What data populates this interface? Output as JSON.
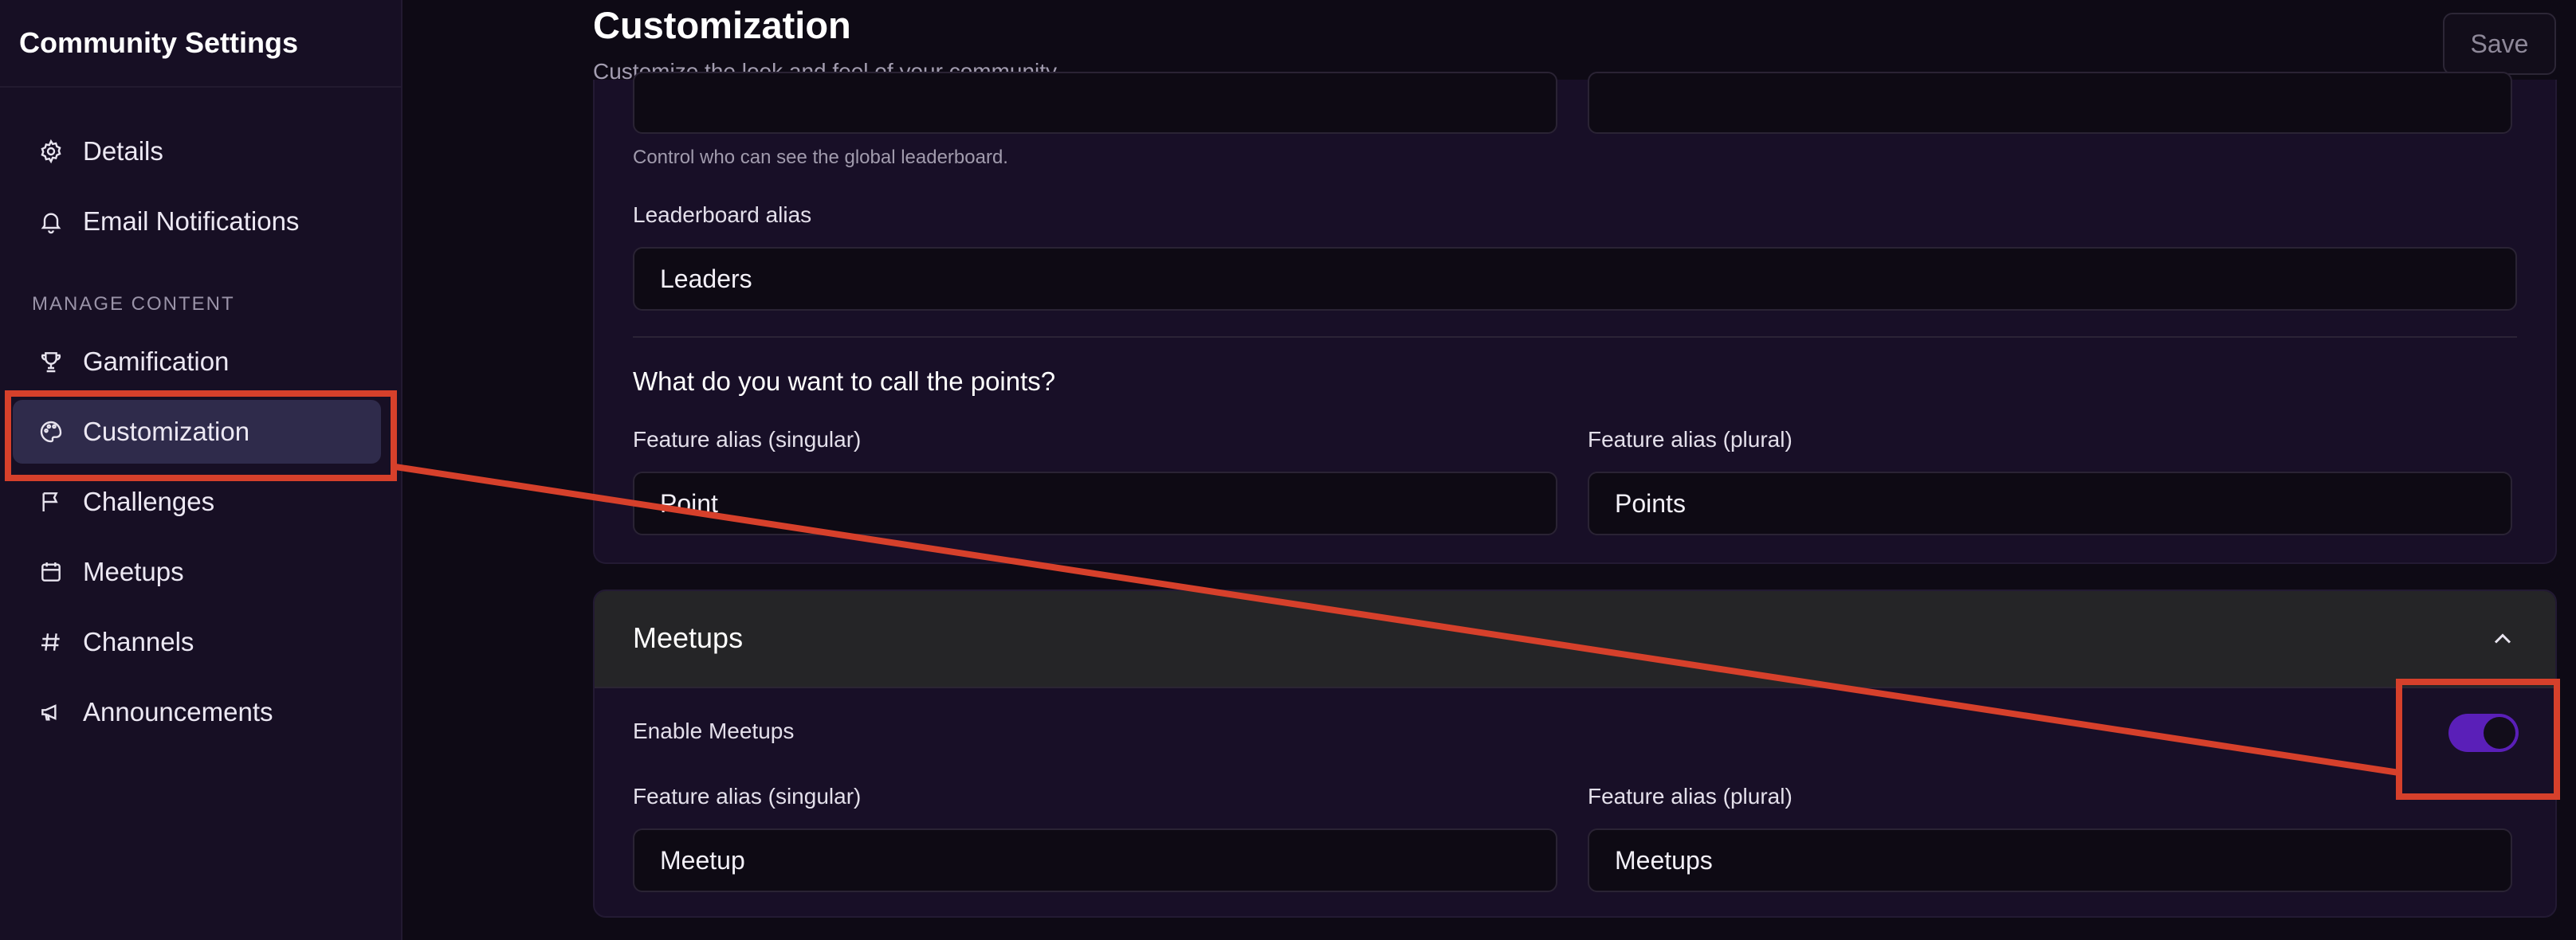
{
  "sidebar": {
    "title": "Community Settings",
    "section_label": "MANAGE CONTENT",
    "items": [
      {
        "label": "Details",
        "icon": "gear-icon"
      },
      {
        "label": "Email Notifications",
        "icon": "bell-icon"
      },
      {
        "label": "Gamification",
        "icon": "trophy-icon"
      },
      {
        "label": "Customization",
        "icon": "palette-icon",
        "active": true
      },
      {
        "label": "Challenges",
        "icon": "flag-icon"
      },
      {
        "label": "Meetups",
        "icon": "calendar-icon"
      },
      {
        "label": "Channels",
        "icon": "hash-icon"
      },
      {
        "label": "Announcements",
        "icon": "megaphone-icon"
      }
    ]
  },
  "header": {
    "title": "Customization",
    "subtitle": "Customize the look and feel of your community",
    "save_label": "Save"
  },
  "leaderboard": {
    "visibility_help": "Control who can see the global leaderboard.",
    "alias_label": "Leaderboard alias",
    "alias_value": "Leaders"
  },
  "points": {
    "question": "What do you want to call the points?",
    "singular_label": "Feature alias (singular)",
    "singular_value": "Point",
    "plural_label": "Feature alias (plural)",
    "plural_value": "Points"
  },
  "meetups": {
    "title": "Meetups",
    "enable_label": "Enable Meetups",
    "enabled": true,
    "singular_label": "Feature alias (singular)",
    "singular_value": "Meetup",
    "plural_label": "Feature alias (plural)",
    "plural_value": "Meetups"
  },
  "colors": {
    "accent": "#5a1fb8",
    "annotation": "#d6402b",
    "active_nav": "#2f2b4b"
  }
}
